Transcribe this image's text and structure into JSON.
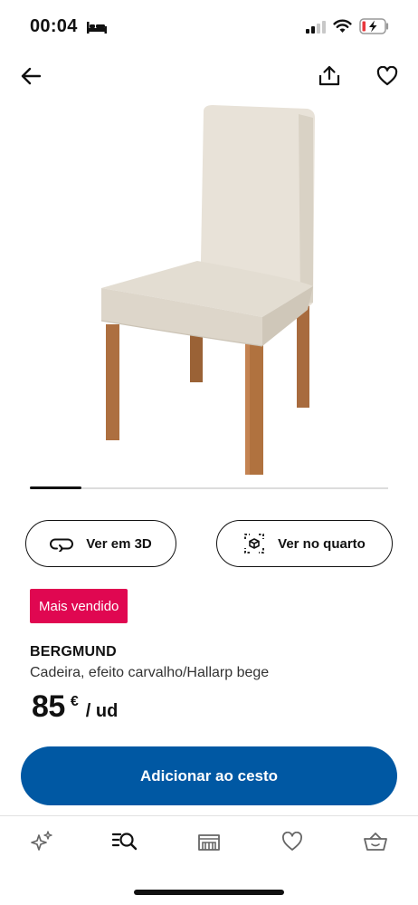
{
  "status_bar": {
    "time": "00:04"
  },
  "product": {
    "badge": "Mais vendido",
    "name": "BERGMUND",
    "description": "Cadeira, efeito carvalho/Hallarp bege",
    "price_integer": "85",
    "price_currency": "€",
    "price_unit": "/ ud"
  },
  "actions": {
    "view_3d_label": "Ver em 3D",
    "view_room_label": "Ver no quarto",
    "add_to_cart_label": "Adicionar ao cesto"
  },
  "carousel": {
    "current": 1,
    "total": 7
  },
  "tabs": [
    {
      "icon": "sparkle-icon"
    },
    {
      "icon": "search-list-icon"
    },
    {
      "icon": "store-icon"
    },
    {
      "icon": "heart-icon"
    },
    {
      "icon": "basket-icon"
    }
  ],
  "colors": {
    "primary": "#0058a3",
    "badge": "#e00751",
    "chair_fabric": "#e8e2d8",
    "chair_legs": "#a86b3e"
  }
}
